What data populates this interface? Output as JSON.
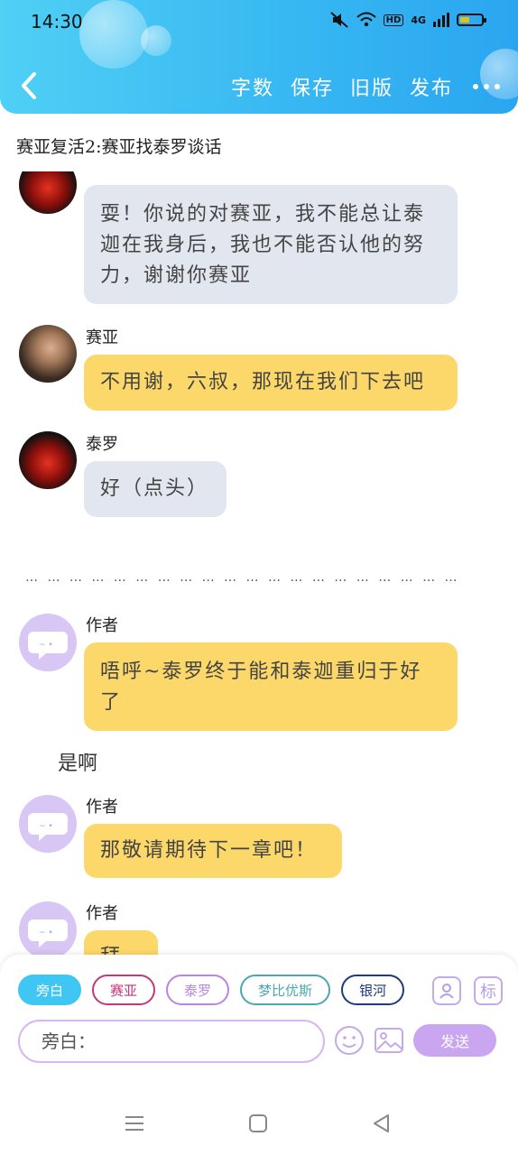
{
  "status": {
    "time": "14:30",
    "hd": "HD",
    "net": "4G"
  },
  "header": {
    "tools": [
      "字数",
      "保存",
      "旧版",
      "发布"
    ]
  },
  "doc_title": "赛亚复活2:赛亚找泰罗谈话",
  "messages": [
    {
      "type": "grey",
      "text": "耍！你说的对赛亚，我不能总让泰迦在我身后，我也不能否认他的努力，谢谢你赛亚"
    },
    {
      "speaker": "赛亚",
      "type": "yellow",
      "text": "不用谢，六叔，那现在我们下去吧"
    },
    {
      "speaker": "泰罗",
      "type": "grey",
      "text": "好（点头）"
    },
    {
      "speaker": "作者",
      "type": "yellow",
      "text": "唔呼~泰罗终于能和泰迦重归于好了"
    },
    {
      "speaker": "作者",
      "type": "yellow",
      "text": "那敬请期待下一章吧！"
    },
    {
      "speaker": "作者",
      "type": "yellow",
      "text": "拜拜"
    }
  ],
  "divider": "… … … … … … … … … … … … … … … … … … … …",
  "plain_text": "是啊",
  "input_panel": {
    "chips": [
      {
        "label": "旁白",
        "color": "#3fc6f2",
        "active": true
      },
      {
        "label": "赛亚",
        "color": "#c0397a",
        "active": false
      },
      {
        "label": "泰罗",
        "color": "#b886e0",
        "active": false
      },
      {
        "label": "梦比优斯",
        "color": "#4aa8ae",
        "active": false
      },
      {
        "label": "银河",
        "color": "#1f3b7a",
        "active": false
      },
      {
        "label": "",
        "color": "#c0397a",
        "active": false
      }
    ],
    "tag_label": "标",
    "placeholder": "旁白：",
    "send_label": "发送"
  }
}
